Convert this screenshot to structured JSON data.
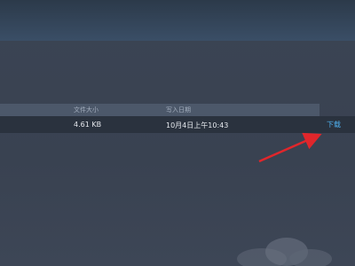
{
  "table": {
    "headers": {
      "size": "文件大小",
      "date": "写入日期"
    },
    "rows": [
      {
        "size": "4.61 KB",
        "date": "10月4日上午10:43",
        "action": "下载"
      }
    ]
  },
  "colors": {
    "background": "#3a4352",
    "header_row": "#4c586a",
    "selected_row": "#2a323e",
    "link": "#4fb0ef",
    "annotation_arrow": "#e0262b"
  }
}
